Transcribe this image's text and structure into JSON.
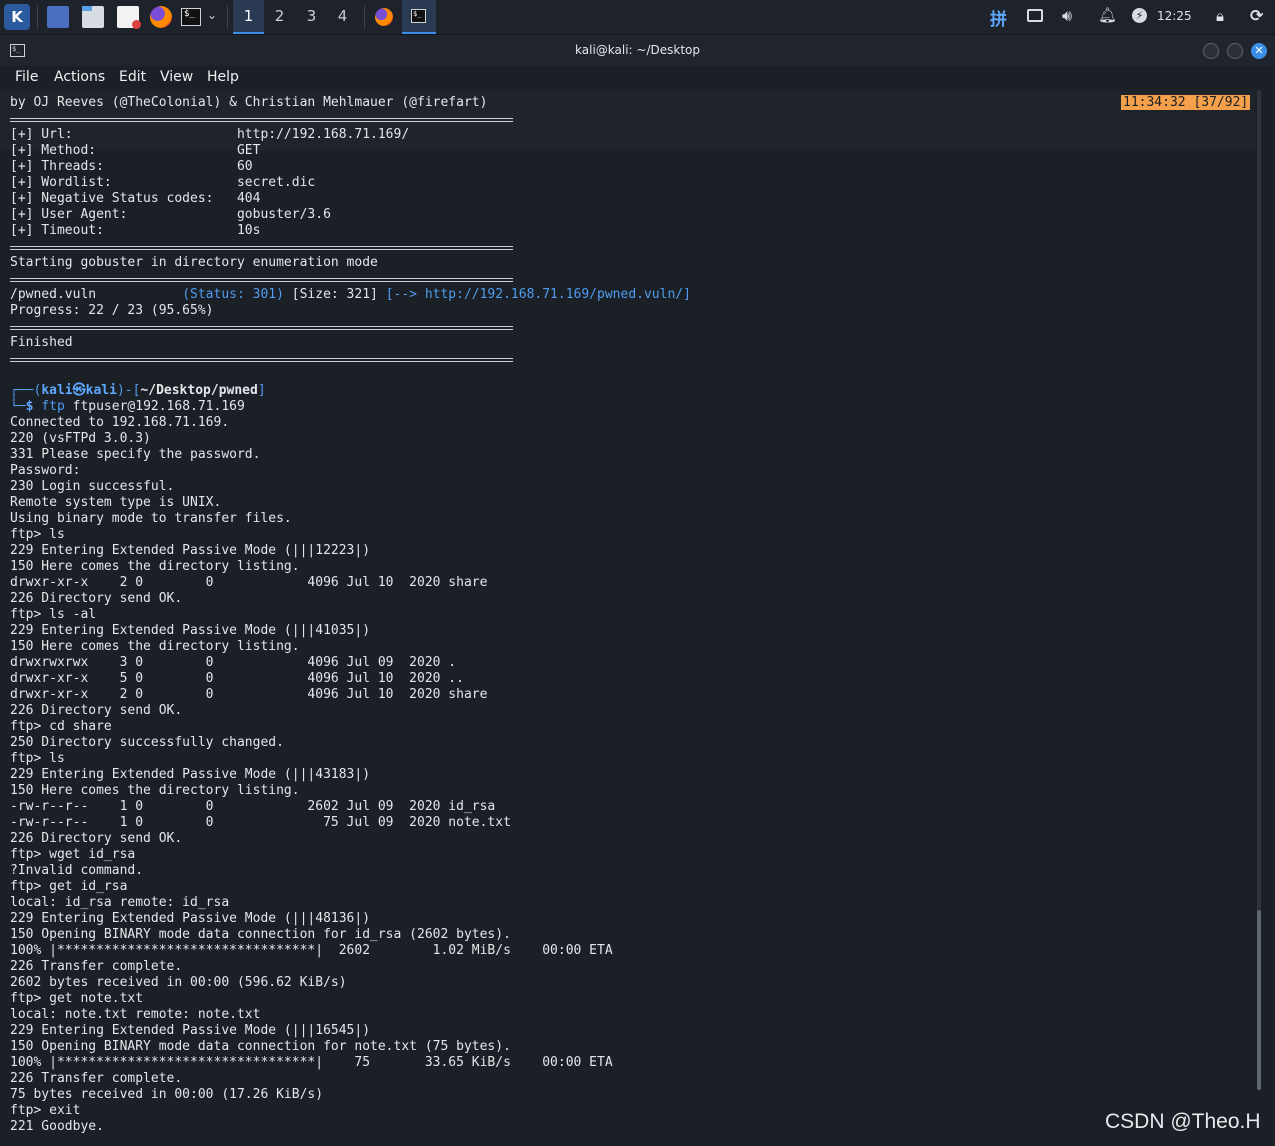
{
  "taskbar": {
    "logo": "kali-logo",
    "workspaces": [
      "1",
      "2",
      "3",
      "4"
    ],
    "active_workspace": "1",
    "tray": {
      "ime": "拼",
      "clock": "12:25",
      "icons": [
        "network-icon",
        "volume-icon",
        "bell-icon",
        "power-icon",
        "lock-icon",
        "logout-icon"
      ]
    }
  },
  "window": {
    "title": "kali@kali: ~/Desktop"
  },
  "menu": [
    "File",
    "Actions",
    "Edit",
    "View",
    "Help"
  ],
  "status_badge": "11:34:32 [37/92]",
  "terminal_lines": [
    {
      "t": "by OJ Reeves (@TheColonial) & Christian Mehlmauer (@firefart)"
    },
    {
      "rule": true
    },
    {
      "t": "[+] Url:                     http://192.168.71.169/"
    },
    {
      "t": "[+] Method:                  GET"
    },
    {
      "t": "[+] Threads:                 60"
    },
    {
      "t": "[+] Wordlist:                secret.dic"
    },
    {
      "t": "[+] Negative Status codes:   404"
    },
    {
      "t": "[+] User Agent:              gobuster/3.6"
    },
    {
      "t": "[+] Timeout:                 10s"
    },
    {
      "rule": true
    },
    {
      "t": "Starting gobuster in directory enumeration mode"
    },
    {
      "rule": true
    },
    {
      "parts": [
        {
          "t": "/pwned.vuln           "
        },
        {
          "t": "(Status: 301)",
          "c": "c-blue"
        },
        {
          "t": " [Size: 321] "
        },
        {
          "t": "[--> http://192.168.71.169/pwned.vuln/]",
          "c": "c-blue"
        }
      ]
    },
    {
      "t": "Progress: 22 / 23 (95.65%)"
    },
    {
      "rule": true
    },
    {
      "t": "Finished"
    },
    {
      "rule": true
    },
    {
      "t": ""
    },
    {
      "parts": [
        {
          "t": "┌──(",
          "c": "prompt-box"
        },
        {
          "t": "kali㉿kali",
          "c": "c-bblue"
        },
        {
          "t": ")-[",
          "c": "prompt-box"
        },
        {
          "t": "~/Desktop/pwned",
          "c": "c-bold"
        },
        {
          "t": "]",
          "c": "prompt-box"
        }
      ]
    },
    {
      "parts": [
        {
          "t": "└─",
          "c": "prompt-box"
        },
        {
          "t": "$ ",
          "c": "c-bblue"
        },
        {
          "t": "ftp",
          "c": "c-blue"
        },
        {
          "t": " ftpuser@192.168.71.169"
        }
      ]
    },
    {
      "t": "Connected to 192.168.71.169."
    },
    {
      "t": "220 (vsFTPd 3.0.3)"
    },
    {
      "t": "331 Please specify the password."
    },
    {
      "t": "Password: "
    },
    {
      "t": "230 Login successful."
    },
    {
      "t": "Remote system type is UNIX."
    },
    {
      "t": "Using binary mode to transfer files."
    },
    {
      "t": "ftp> ls"
    },
    {
      "t": "229 Entering Extended Passive Mode (|||12223|)"
    },
    {
      "t": "150 Here comes the directory listing."
    },
    {
      "t": "drwxr-xr-x    2 0        0            4096 Jul 10  2020 share"
    },
    {
      "t": "226 Directory send OK."
    },
    {
      "t": "ftp> ls -al"
    },
    {
      "t": "229 Entering Extended Passive Mode (|||41035|)"
    },
    {
      "t": "150 Here comes the directory listing."
    },
    {
      "t": "drwxrwxrwx    3 0        0            4096 Jul 09  2020 ."
    },
    {
      "t": "drwxr-xr-x    5 0        0            4096 Jul 10  2020 .."
    },
    {
      "t": "drwxr-xr-x    2 0        0            4096 Jul 10  2020 share"
    },
    {
      "t": "226 Directory send OK."
    },
    {
      "t": "ftp> cd share"
    },
    {
      "t": "250 Directory successfully changed."
    },
    {
      "t": "ftp> ls"
    },
    {
      "t": "229 Entering Extended Passive Mode (|||43183|)"
    },
    {
      "t": "150 Here comes the directory listing."
    },
    {
      "t": "-rw-r--r--    1 0        0            2602 Jul 09  2020 id_rsa"
    },
    {
      "t": "-rw-r--r--    1 0        0              75 Jul 09  2020 note.txt"
    },
    {
      "t": "226 Directory send OK."
    },
    {
      "t": "ftp> wget id_rsa"
    },
    {
      "t": "?Invalid command."
    },
    {
      "t": "ftp> get id_rsa"
    },
    {
      "t": "local: id_rsa remote: id_rsa"
    },
    {
      "t": "229 Entering Extended Passive Mode (|||48136|)"
    },
    {
      "t": "150 Opening BINARY mode data connection for id_rsa (2602 bytes)."
    },
    {
      "t": "100% |*********************************|  2602        1.02 MiB/s    00:00 ETA"
    },
    {
      "t": "226 Transfer complete."
    },
    {
      "t": "2602 bytes received in 00:00 (596.62 KiB/s)"
    },
    {
      "t": "ftp> get note.txt"
    },
    {
      "t": "local: note.txt remote: note.txt"
    },
    {
      "t": "229 Entering Extended Passive Mode (|||16545|)"
    },
    {
      "t": "150 Opening BINARY mode data connection for note.txt (75 bytes)."
    },
    {
      "t": "100% |*********************************|    75       33.65 KiB/s    00:00 ETA"
    },
    {
      "t": "226 Transfer complete."
    },
    {
      "t": "75 bytes received in 00:00 (17.26 KiB/s)"
    },
    {
      "t": "ftp> exit"
    },
    {
      "t": "221 Goodbye."
    }
  ],
  "watermark": "CSDN @Theo.H"
}
